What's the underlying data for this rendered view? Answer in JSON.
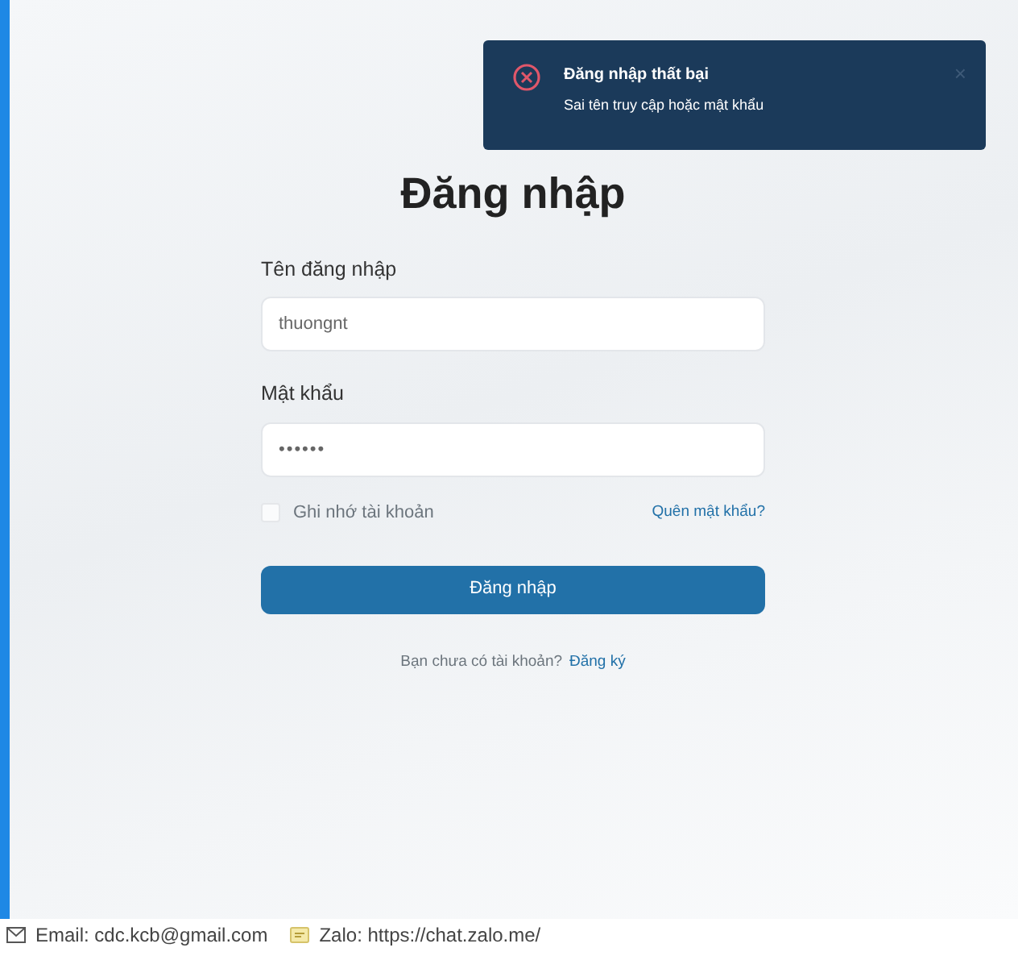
{
  "toast": {
    "title": "Đăng nhập thất bại",
    "message": "Sai tên truy cập hoặc mật khẩu",
    "close": "×"
  },
  "form": {
    "heading": "Đăng nhập",
    "fields": [
      {
        "label": "Tên đăng nhập",
        "value": "thuongnt",
        "kind": "text"
      },
      {
        "label": "Mật khẩu",
        "value": "••••••",
        "kind": "password"
      }
    ],
    "remember": {
      "label": "Ghi nhớ tài khoản",
      "checked": false
    },
    "forgot_link": "Quên mật khẩu?",
    "submit": "Đăng nhập",
    "signup_prompt": "Bạn chưa có tài khoản?",
    "signup_link": "Đăng ký"
  },
  "footer": {
    "email": "Email: cdc.kcb@gmail.com",
    "zalo": "Zalo: https://chat.zalo.me/"
  }
}
